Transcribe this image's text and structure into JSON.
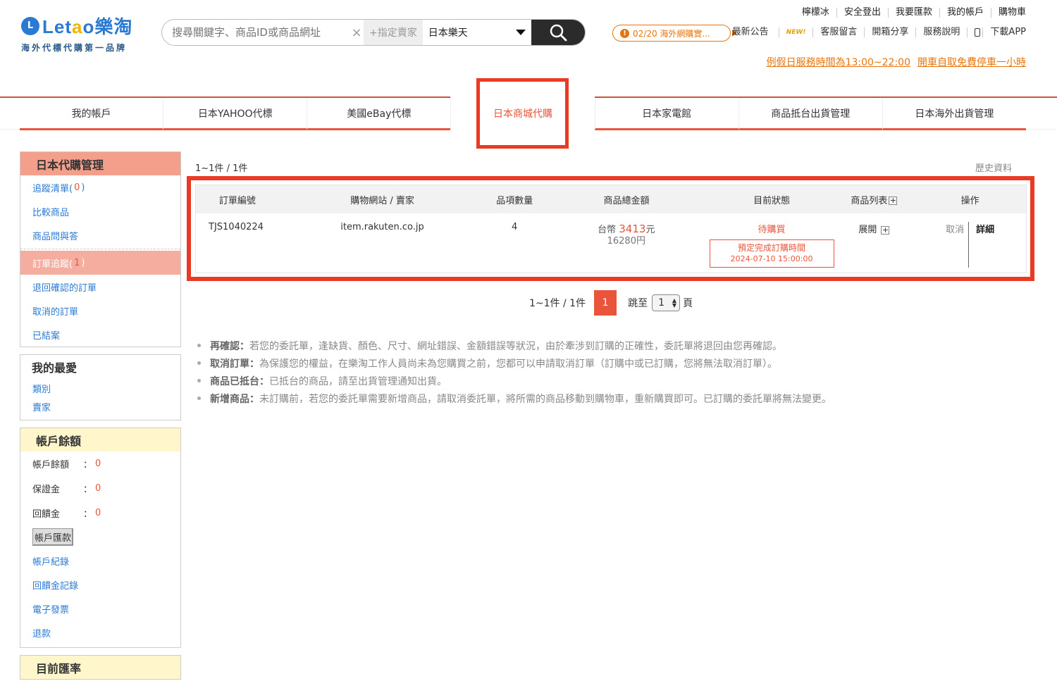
{
  "brand": {
    "icon": "L",
    "name_prefix": "Let",
    "name_o": "a",
    "name_suffix": "o樂淘",
    "slogan": "海外代標代購第一品牌"
  },
  "search": {
    "placeholder": "搜尋關鍵字、商品ID或商品網址",
    "seller_label": "+指定賣家",
    "store_value": "日本樂天"
  },
  "top_links": [
    "檸檬冰",
    "安全登出",
    "我要匯款",
    "我的帳戶",
    "購物車"
  ],
  "notice": {
    "icon": "!",
    "text": "02/20 海外網購實..."
  },
  "sub_links": {
    "news": "最新公告",
    "new_badge": "NEW!",
    "message": "客服留言",
    "unbox": "開箱分享",
    "help": "服務說明",
    "app": "下載APP"
  },
  "hours": [
    "例假日服務時間為13:00~22:00",
    "開車自取免費停車一小時"
  ],
  "nav_tabs": [
    "我的帳戶",
    "日本YAHOO代標",
    "美國eBay代標",
    "日本商城代購",
    "日本家電館",
    "商品抵台出貨管理",
    "日本海外出貨管理"
  ],
  "sidebar": {
    "mgmt_title": "日本代購管理",
    "tracking_list": "追蹤清單(",
    "tracking_count": "0",
    "tracking_close": ")",
    "compare": "比較商品",
    "qa": "商品問與答",
    "order_track": "訂單追蹤(",
    "order_count": "1",
    "order_close": ")",
    "returned": "退回確認的訂單",
    "cancelled": "取消的訂單",
    "closed": "已結案",
    "fav_title": "我的最愛",
    "fav_category": "類別",
    "fav_seller": "賣家",
    "balance_title": "帳戶餘額",
    "balance_rows": [
      {
        "label": "帳戶餘額",
        "value": "0"
      },
      {
        "label": "保證金",
        "value": "0"
      },
      {
        "label": "回饋金",
        "value": "0"
      }
    ],
    "colon": "：",
    "remit_button": "帳戶匯款",
    "account_record": "帳戶紀錄",
    "rebate_record": "回饋金記錄",
    "invoice": "電子發票",
    "refund": "退款",
    "rate_title": "目前匯率"
  },
  "main": {
    "count_top": "1~1件 / 1件",
    "history": "歷史資料",
    "headers": [
      "訂單編號",
      "購物網站 / 賣家",
      "品項數量",
      "商品總金額",
      "目前狀態",
      "商品列表",
      "操作"
    ],
    "header_plus": "+",
    "order": {
      "id": "TJS1040224",
      "site": "item.rakuten.co.jp",
      "qty": "4",
      "currency": "台幣",
      "amount": "3413",
      "unit": "元",
      "yen": "16280円",
      "status": "待購買",
      "deadline_label": "預定完成訂購時間",
      "deadline_time": "2024-07-10 15:00:00",
      "expand": "展開",
      "expand_plus": "+",
      "cancel": "取消",
      "detail": "詳細"
    },
    "pager": {
      "count": "1~1件 / 1件",
      "current_page": "1",
      "jump_label": "跳至",
      "jump_value": "1",
      "page_suffix": "頁"
    },
    "notes": [
      {
        "title": "再確認：",
        "text": "若您的委託單，逢缺貨、顏色、尺寸、網址錯誤、金額錯誤等狀況，由於牽涉到訂購的正確性，委託單將退回由您再確認。"
      },
      {
        "title": "取消訂單：",
        "text": "為保護您的權益，在樂淘工作人員尚未為您購買之前，您都可以申請取消訂單（訂購中或已訂購，您將無法取消訂單）。"
      },
      {
        "title": "商品已抵台：",
        "text": "已抵台的商品，請至出貨管理通知出貨。"
      },
      {
        "title": "新增商品：",
        "text": "未訂購前，若您的委託單需要新增商品，請取消委託單，將所需的商品移動到購物車，重新購買即可。已訂購的委託單將無法變更。"
      }
    ]
  }
}
